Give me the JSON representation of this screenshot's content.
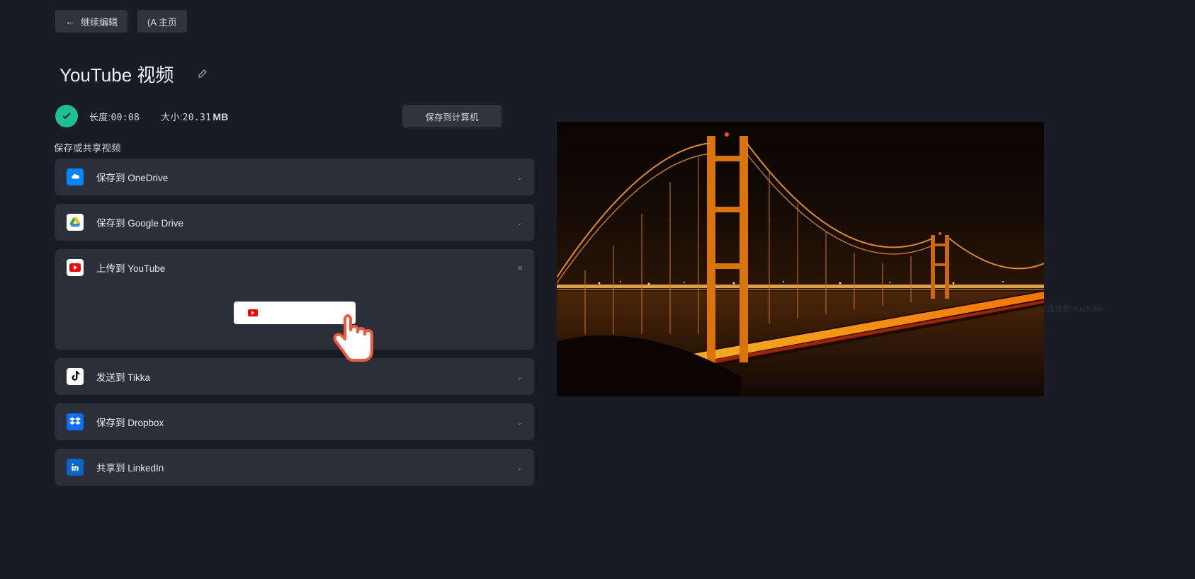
{
  "top": {
    "continue_edit": "继续编辑",
    "home": "(A 主页"
  },
  "title": "YouTube 视频",
  "meta": {
    "length_label": "长度:",
    "length_value": "00:08",
    "size_label": "大小:",
    "size_value": "20.31",
    "size_unit": "MB"
  },
  "save_to_computer": "保存到计算机",
  "share_label": "保存或共享视频",
  "services": {
    "onedrive": "保存到 OneDrive",
    "gdrive": "保存到 Google Drive",
    "youtube": "上传到 YouTube",
    "tiktok": "发送到 Tikka",
    "dropbox": "保存到 Dropbox",
    "linkedin": "共享到 LinkedIn"
  },
  "side_note": "连接到 YouTube"
}
